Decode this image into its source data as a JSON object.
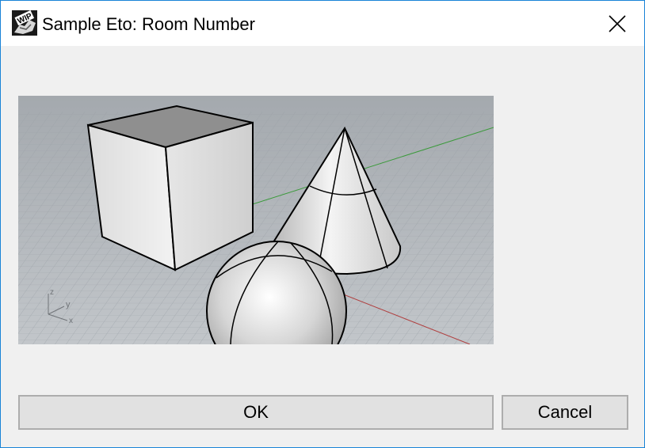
{
  "window": {
    "title": "Sample Eto: Room Number"
  },
  "icons": {
    "app": "rhino-wip-icon",
    "close": "close-icon"
  },
  "viewport": {
    "axis_labels": {
      "z": "z",
      "y": "y",
      "x": "x"
    }
  },
  "buttons": {
    "ok_label": "OK",
    "cancel_label": "Cancel"
  },
  "colors": {
    "accent_border": "#1883d7",
    "dialog_bg": "#f0f0f0",
    "button_bg": "#e1e1e1",
    "grid_x_axis": "#b04040",
    "grid_y_axis": "#3a9a3a"
  }
}
